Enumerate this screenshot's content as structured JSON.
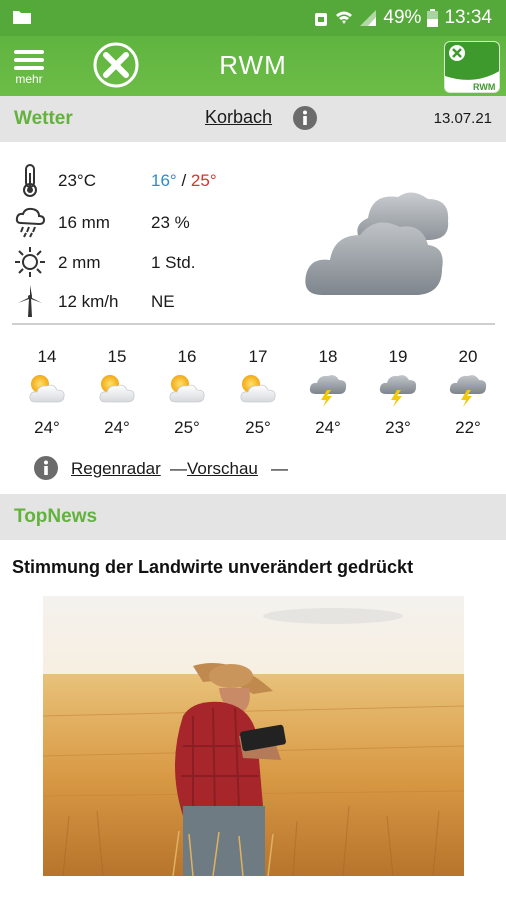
{
  "statusbar": {
    "battery": "49%",
    "time": "13:34"
  },
  "appbar": {
    "menu_label": "mehr",
    "title": "RWM",
    "brand_text": "RWM"
  },
  "weather": {
    "section_title": "Wetter",
    "location": "Korbach",
    "date": "13.07.21",
    "current": {
      "temperature": "23°C",
      "temp_min": "16°",
      "temp_sep": "/",
      "temp_max": "25°",
      "precipitation": "16 mm",
      "precip_probability": "23 %",
      "sun_value": "2 mm",
      "sun_hours": "1 Std.",
      "wind_speed": "12 km/h",
      "wind_direction": "NE"
    },
    "forecast": [
      {
        "day": "14",
        "icon": "sun-cloud-icon",
        "temp": "24°"
      },
      {
        "day": "15",
        "icon": "sun-cloud-icon",
        "temp": "24°"
      },
      {
        "day": "16",
        "icon": "sun-cloud-icon",
        "temp": "25°"
      },
      {
        "day": "17",
        "icon": "sun-cloud-icon",
        "temp": "25°"
      },
      {
        "day": "18",
        "icon": "thunderstorm-icon",
        "temp": "24°"
      },
      {
        "day": "19",
        "icon": "thunderstorm-icon",
        "temp": "23°"
      },
      {
        "day": "20",
        "icon": "thunderstorm-icon",
        "temp": "22°"
      }
    ],
    "links": {
      "radar": "Regenradar",
      "dash": "—",
      "preview": "Vorschau",
      "dash2": "—"
    }
  },
  "topnews": {
    "section_title": "TopNews",
    "headline": "Stimmung der Landwirte unverändert gedrückt"
  },
  "colors": {
    "brand_green": "#63b23d",
    "temp_min": "#2f8bc9",
    "temp_max": "#d9322c"
  }
}
